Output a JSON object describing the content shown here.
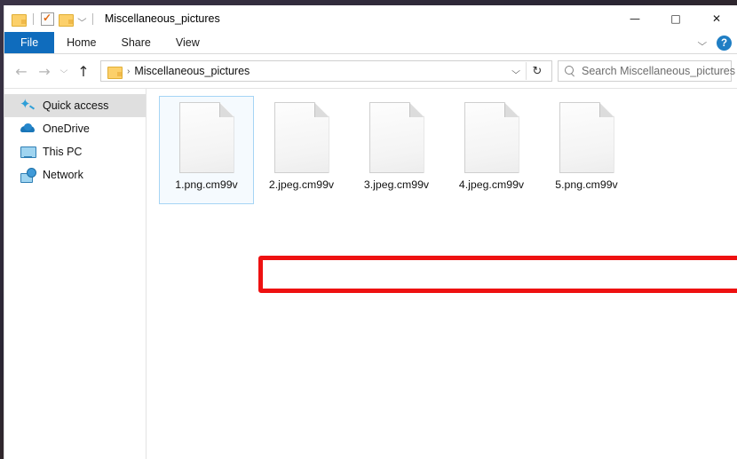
{
  "window": {
    "title": "Miscellaneous_pictures",
    "quick_access_toolbar": [
      {
        "name": "folder-icon",
        "label": "Folder"
      },
      {
        "name": "properties-icon",
        "label": "Properties"
      },
      {
        "name": "new-folder-icon",
        "label": "New folder"
      },
      {
        "name": "chevron-down-icon",
        "label": "Customize Quick Access Toolbar",
        "glyph": "⌵"
      }
    ],
    "controls": {
      "minimize": "—",
      "maximize": "□",
      "close": "✕"
    }
  },
  "ribbon": {
    "tabs": [
      {
        "label": "File",
        "active": true
      },
      {
        "label": "Home",
        "active": false
      },
      {
        "label": "Share",
        "active": false
      },
      {
        "label": "View",
        "active": false
      }
    ],
    "collapse_glyph": "⌵",
    "help_label": "?"
  },
  "navbar": {
    "back": "←",
    "forward": "→",
    "recent": "⌵",
    "up": "↑",
    "address": {
      "folder_icon": "folder-icon",
      "separator": "›",
      "path": "Miscellaneous_pictures",
      "dropdown_glyph": "⌵",
      "refresh_glyph": "↻"
    },
    "search": {
      "placeholder": "Search Miscellaneous_pictures",
      "icon": "search-icon"
    }
  },
  "sidebar": {
    "items": [
      {
        "label": "Quick access",
        "icon": "pin-icon",
        "selected": true
      },
      {
        "label": "OneDrive",
        "icon": "cloud-icon",
        "selected": false
      },
      {
        "label": "This PC",
        "icon": "monitor-icon",
        "selected": false
      },
      {
        "label": "Network",
        "icon": "network-icon",
        "selected": false
      }
    ]
  },
  "content": {
    "files": [
      {
        "name": "1.png.cm99v",
        "selected": true
      },
      {
        "name": "2.jpeg.cm99v",
        "selected": false
      },
      {
        "name": "3.jpeg.cm99v",
        "selected": false
      },
      {
        "name": "4.jpeg.cm99v",
        "selected": false
      },
      {
        "name": "5.png.cm99v",
        "selected": false
      }
    ]
  },
  "annotation": {
    "color": "#ee1111",
    "shape": "rectangle"
  },
  "colors": {
    "accent": "#0f6cbd",
    "selection_border": "#a6d5f5",
    "annotation_red": "#ee1111",
    "sidebar_selected": "#dfdfdf"
  }
}
